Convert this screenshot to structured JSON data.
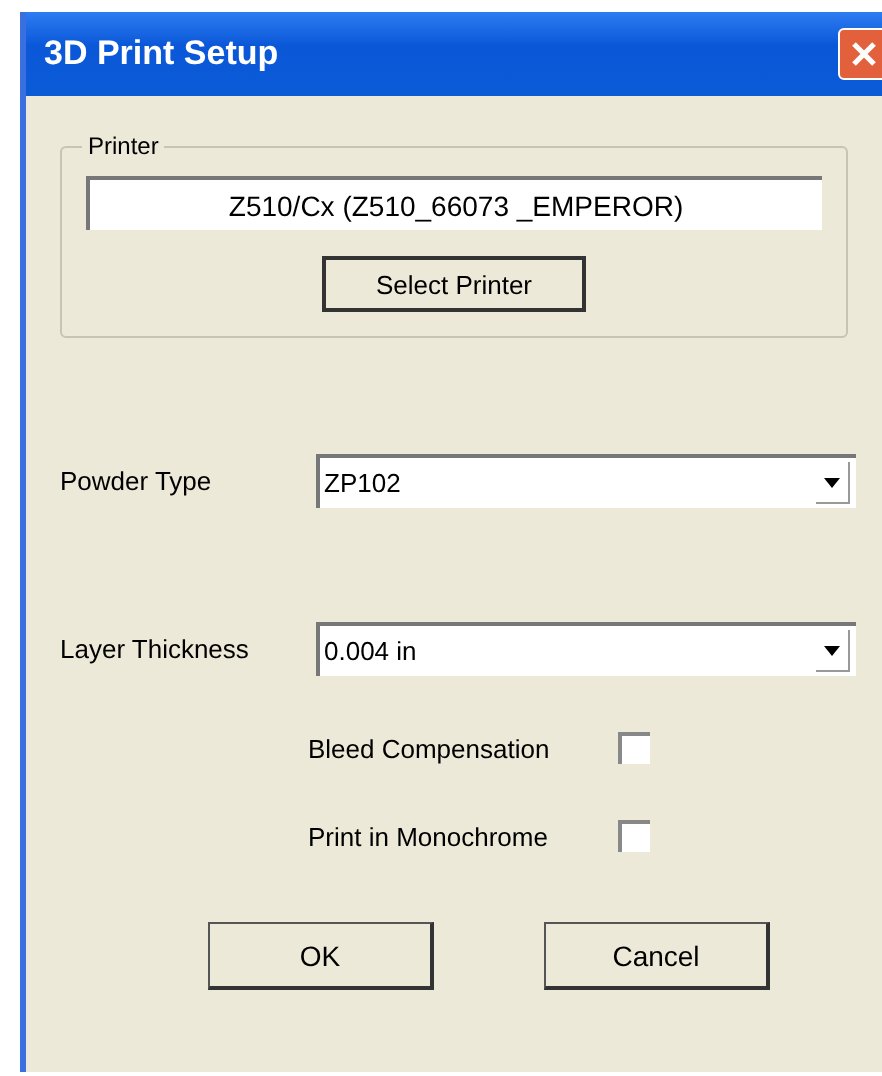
{
  "window": {
    "title": "3D Print Setup"
  },
  "printer_group": {
    "legend": "Printer",
    "printer_name": "Z510/Cx (Z510_66073 _EMPEROR)",
    "button": "Select Printer"
  },
  "fields": [
    {
      "label": "Powder Type",
      "value": "ZP102"
    },
    {
      "label": "Layer Thickness",
      "value": "0.004 in"
    }
  ],
  "options": [
    {
      "label": "Bleed Compensation",
      "checked": false
    },
    {
      "label": "Print in Monochrome",
      "checked": false
    }
  ],
  "buttons": [
    "OK",
    "Cancel"
  ]
}
